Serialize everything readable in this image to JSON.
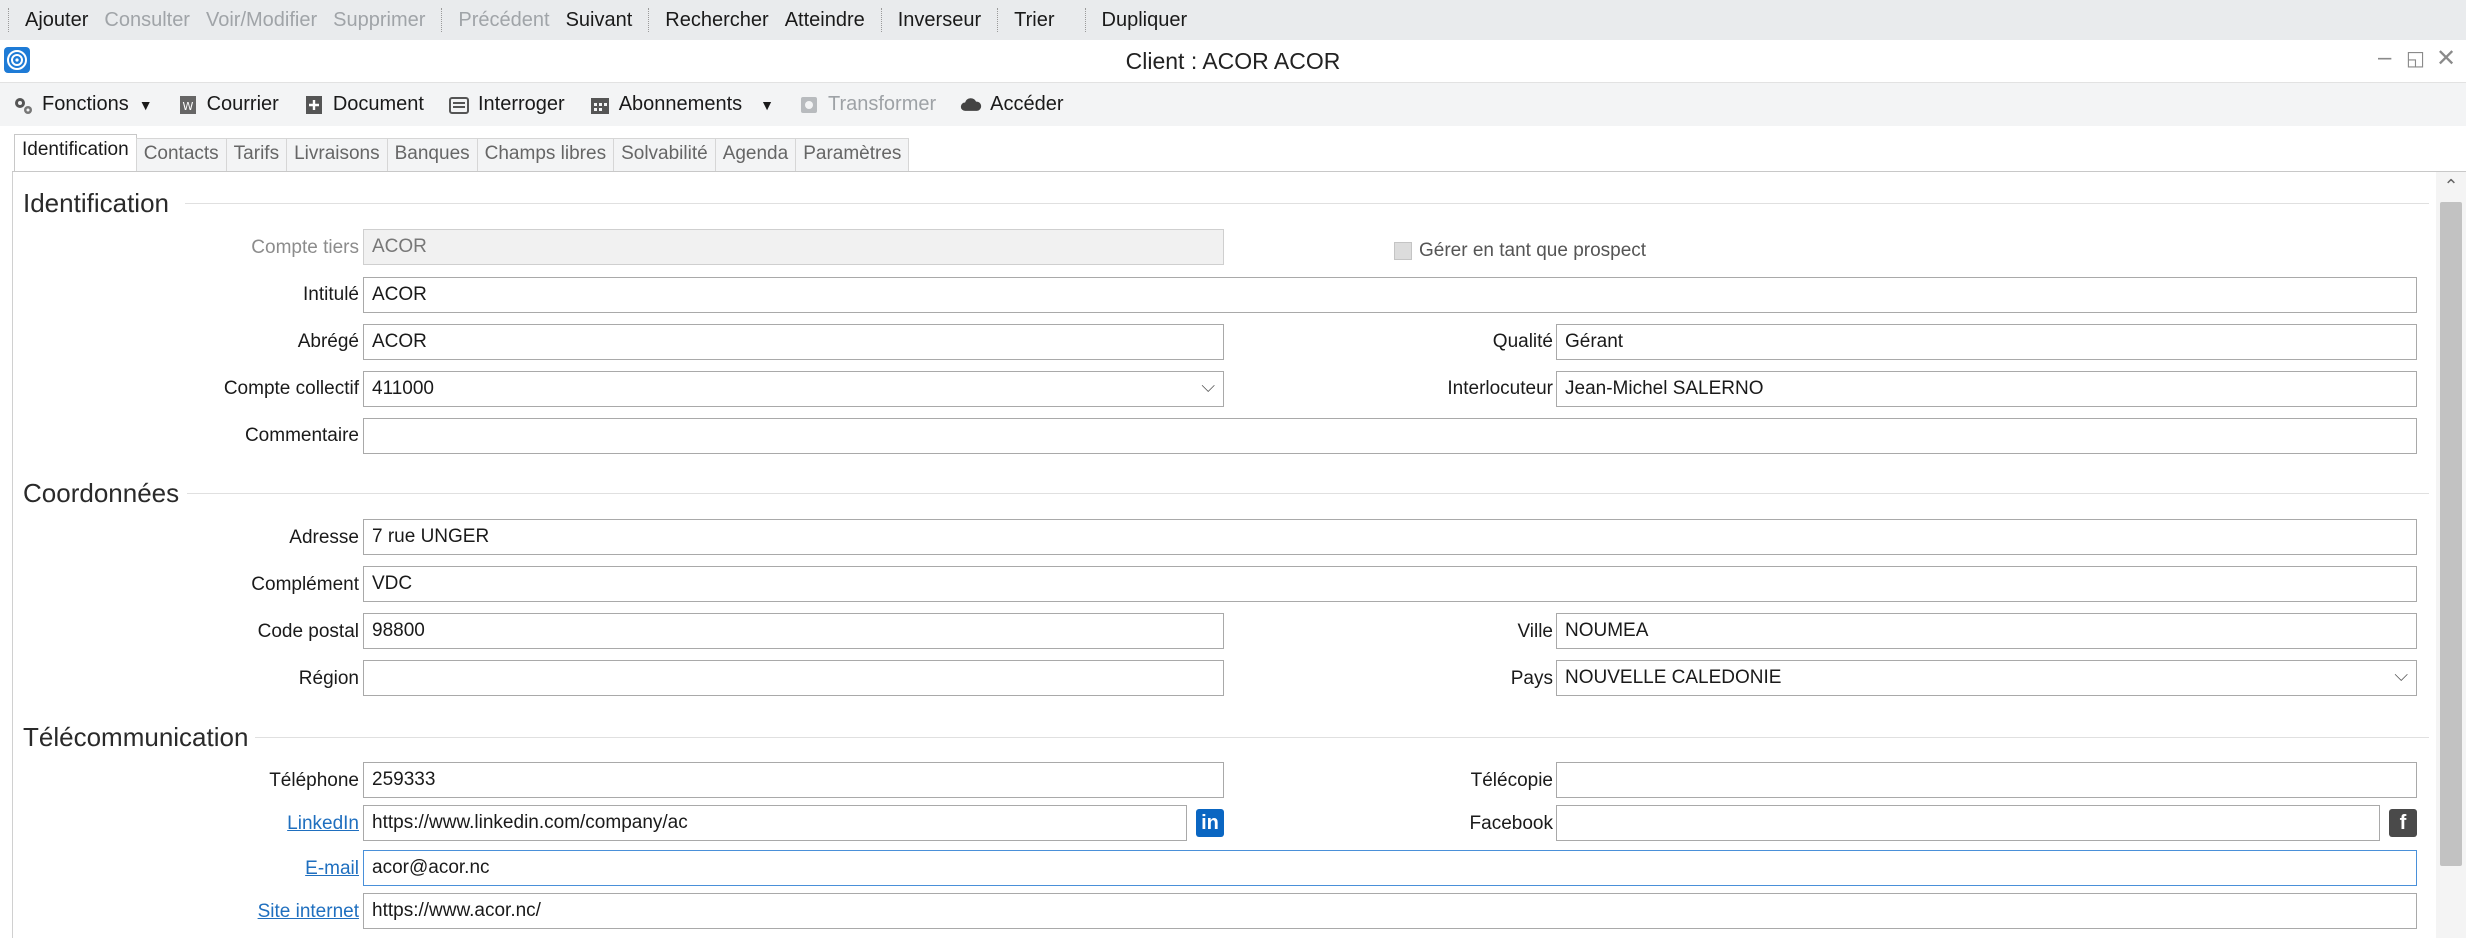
{
  "command_bar": {
    "items": [
      {
        "label": "Ajouter",
        "enabled": true
      },
      {
        "label": "Consulter",
        "enabled": false
      },
      {
        "label": "Voir/Modifier",
        "enabled": false
      },
      {
        "label": "Supprimer",
        "enabled": false
      },
      {
        "label": "Précédent",
        "enabled": false
      },
      {
        "label": "Suivant",
        "enabled": true
      },
      {
        "label": "Rechercher",
        "enabled": true
      },
      {
        "label": "Atteindre",
        "enabled": true
      },
      {
        "label": "Inverseur",
        "enabled": true
      },
      {
        "label": "Trier",
        "enabled": true
      },
      {
        "label": "Dupliquer",
        "enabled": true
      }
    ]
  },
  "window": {
    "title": "Client : ACOR ACOR"
  },
  "toolbar": {
    "fonctions": "Fonctions",
    "courrier": "Courrier",
    "document": "Document",
    "interroger": "Interroger",
    "abonnements": "Abonnements",
    "transformer": "Transformer",
    "acceder": "Accéder"
  },
  "tabs": [
    "Identification",
    "Contacts",
    "Tarifs",
    "Livraisons",
    "Banques",
    "Champs libres",
    "Solvabilité",
    "Agenda",
    "Paramètres"
  ],
  "identification": {
    "title": "Identification",
    "compte_tiers_label": "Compte tiers",
    "compte_tiers": "ACOR",
    "prospect_label": "Gérer en tant que prospect",
    "intitule_label": "Intitulé",
    "intitule": "ACOR",
    "abrege_label": "Abrégé",
    "abrege": "ACOR",
    "qualite_label": "Qualité",
    "qualite": "Gérant",
    "compte_collectif_label": "Compte collectif",
    "compte_collectif": "411000",
    "interlocuteur_label": "Interlocuteur",
    "interlocuteur": "Jean-Michel SALERNO",
    "commentaire_label": "Commentaire",
    "commentaire": ""
  },
  "coordonnees": {
    "title": "Coordonnées",
    "adresse_label": "Adresse",
    "adresse": "7 rue UNGER",
    "complement_label": "Complément",
    "complement": "VDC",
    "code_postal_label": "Code postal",
    "code_postal": "98800",
    "ville_label": "Ville",
    "ville": "NOUMEA",
    "region_label": "Région",
    "region": "",
    "pays_label": "Pays",
    "pays": "NOUVELLE CALEDONIE"
  },
  "telecommunication": {
    "title": "Télécommunication",
    "telephone_label": "Téléphone",
    "telephone": "259333",
    "telecopie_label": "Télécopie",
    "telecopie": "",
    "linkedin_label": "LinkedIn",
    "linkedin": "https://www.linkedin.com/company/ac",
    "facebook_label": "Facebook",
    "facebook": "",
    "email_label": "E-mail",
    "email": "acor@acor.nc",
    "site_label": "Site internet",
    "site": "https://www.acor.nc/"
  },
  "colors": {
    "accent": "#1e7bd6",
    "linkedin": "#0a66c2",
    "link": "#1f6fbf"
  }
}
